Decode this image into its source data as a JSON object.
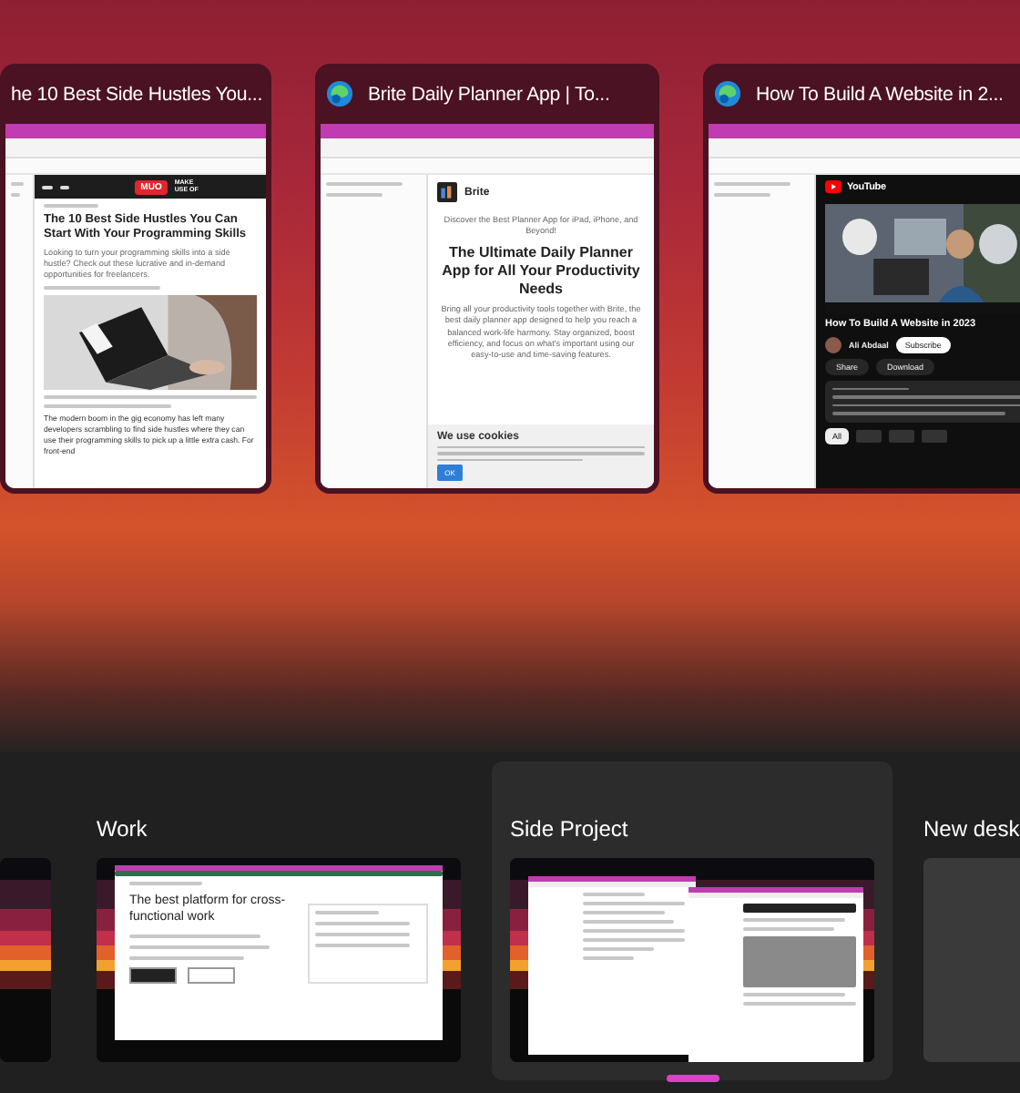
{
  "windows": [
    {
      "title": "he 10 Best Side Hustles You...",
      "show_icon": false,
      "page": {
        "kind": "article",
        "logo": "MUO",
        "logo_sub": "MAKE USE OF",
        "headline": "The 10 Best Side Hustles You Can Start With Your Programming Skills",
        "subtitle": "Looking to turn your programming skills into a side hustle? Check out these lucrative and in-demand opportunities for freelancers.",
        "body": "The modern boom in the gig economy has left many developers scrambling to find side hustles where they can use their programming skills to pick up a little extra cash. For front-end"
      }
    },
    {
      "title": "Brite Daily Planner App | To...",
      "show_icon": true,
      "page": {
        "kind": "landing",
        "brand": "Brite",
        "tagline": "Discover the Best Planner App for iPad, iPhone, and Beyond!",
        "headline": "The Ultimate Daily Planner App for All Your Productivity Needs",
        "body": "Bring all your productivity tools together with Brite, the best daily planner app designed to help you reach a balanced work-life harmony. Stay organized, boost efficiency, and focus on what's important using our easy-to-use and time-saving features.",
        "cookie_title": "We use cookies",
        "cookie_button": "OK"
      }
    },
    {
      "title": "How To Build A Website in 2...",
      "show_icon": true,
      "page": {
        "kind": "video",
        "logo": "YouTube",
        "title": "How To Build A Website in 2023",
        "channel": "Ali Abdaal",
        "subscribe": "Subscribe",
        "actions": [
          "Share",
          "Download"
        ],
        "chips": [
          "All"
        ]
      }
    }
  ],
  "desktops": [
    {
      "selected": false,
      "kind": "blank"
    },
    {
      "label": "Work",
      "selected": false,
      "kind": "work",
      "headline": "The best platform for cross-functional work"
    },
    {
      "label": "Side Project",
      "selected": true,
      "kind": "browsers"
    },
    {
      "label": "New desk",
      "selected": false,
      "kind": "new"
    }
  ]
}
